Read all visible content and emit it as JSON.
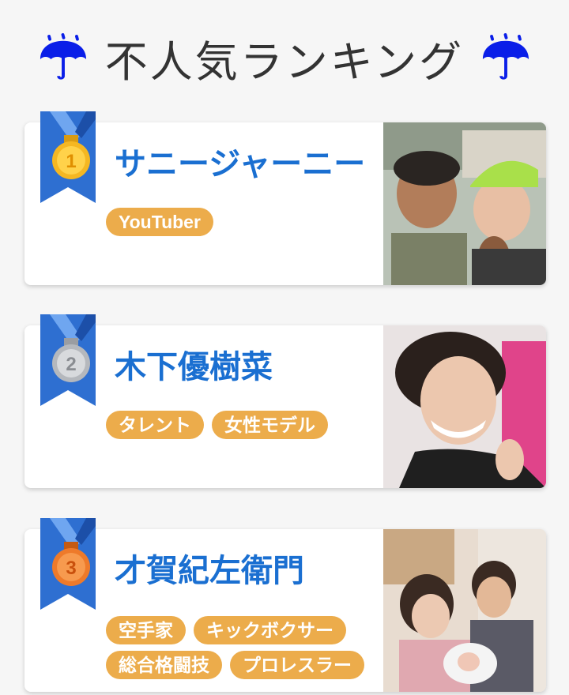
{
  "header": {
    "title": "不人気ランキング",
    "left_icon": "umbrella-rain-icon",
    "right_icon": "umbrella-rain-icon"
  },
  "colors": {
    "umbrella": "#0a1ee8",
    "name": "#1a6fd1",
    "tag": "#ecac4b",
    "ribbon": "#2e6fd1",
    "gold": "#f5b722",
    "silver": "#c7c9cc",
    "bronze": "#ee7a2a"
  },
  "ranking": [
    {
      "rank": "1",
      "medal_icon": "gold-medal-icon",
      "name": "サニージャーニー",
      "tags": [
        "YouTuber"
      ]
    },
    {
      "rank": "2",
      "medal_icon": "silver-medal-icon",
      "name": "木下優樹菜",
      "tags": [
        "タレント",
        "女性モデル"
      ]
    },
    {
      "rank": "3",
      "medal_icon": "bronze-medal-icon",
      "name": "才賀紀左衛門",
      "tags": [
        "空手家",
        "キックボクサー",
        "総合格闘技",
        "プロレスラー"
      ]
    }
  ]
}
